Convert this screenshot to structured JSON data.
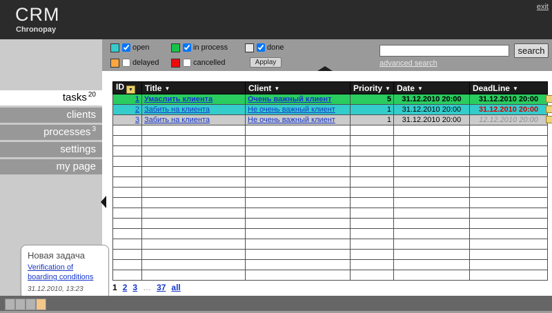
{
  "header": {
    "logo_title": "CRM",
    "logo_subtitle": "Chronopay",
    "exit_label": "exit"
  },
  "filters": {
    "items": [
      {
        "label": "open",
        "swatch_color": "#35cccc",
        "checked": true
      },
      {
        "label": "in process",
        "swatch_color": "#17c24a",
        "checked": true
      },
      {
        "label": "done",
        "swatch_color": "#e8e8e8",
        "checked": true
      },
      {
        "label": "delayed",
        "swatch_color": "#ffa640",
        "checked": false
      },
      {
        "label": "cancelled",
        "swatch_color": "#ea0c0c",
        "checked": false
      }
    ],
    "apply_label": "Applay"
  },
  "search": {
    "value": "",
    "button_label": "search",
    "advanced_label": "advanced search"
  },
  "sidebar": {
    "items": [
      {
        "label": "tasks",
        "badge": "20",
        "active": true
      },
      {
        "label": "clients",
        "badge": "",
        "active": false
      },
      {
        "label": "processes",
        "badge": "3",
        "active": false
      },
      {
        "label": "settings",
        "badge": "",
        "active": false
      },
      {
        "label": "my page",
        "badge": "",
        "active": false
      }
    ]
  },
  "notification": {
    "title": "Новая задача",
    "link": "Verification of boarding conditions",
    "timestamp": "31.12.2010, 13:23"
  },
  "table": {
    "sort_arrow": "▼",
    "columns": [
      {
        "label": "ID"
      },
      {
        "label": "Title"
      },
      {
        "label": "Client"
      },
      {
        "label": "Priority"
      },
      {
        "label": "Date"
      },
      {
        "label": "DeadLine"
      }
    ],
    "rows": [
      {
        "id": "1",
        "title": "Умаслить клиента",
        "client": "Очень важный клиент",
        "priority": "5",
        "date": "31.12.2010 20:00",
        "deadline": "31.12.2010 20:00",
        "row_color": "#2acc60",
        "bold": true,
        "deadline_style": "normal",
        "has_note": true
      },
      {
        "id": "2",
        "title": "Забить на клиента",
        "client": "Не очень важный клиент",
        "priority": "1",
        "date": "31.12.2010 20:00",
        "deadline": "31.12.2010 20:00",
        "row_color": "#35cccc",
        "bold": false,
        "deadline_style": "overdue-red",
        "has_note": true
      },
      {
        "id": "3",
        "title": "Забить на клиента",
        "client": "Не очень важный клиент",
        "priority": "1",
        "date": "31.12.2010 20:00",
        "deadline": "12.12.2010 20:00",
        "row_color": "#cbcbcb",
        "bold": false,
        "deadline_style": "past-gray",
        "has_note": true
      }
    ],
    "empty_row_count": 15
  },
  "pagination": {
    "items": [
      {
        "label": "1",
        "kind": "current"
      },
      {
        "label": "2",
        "kind": "link"
      },
      {
        "label": "3",
        "kind": "link"
      },
      {
        "label": "…",
        "kind": "ellipsis"
      },
      {
        "label": "37",
        "kind": "link"
      },
      {
        "label": "all",
        "kind": "link"
      }
    ]
  },
  "bottom_bar": {
    "squares": [
      {
        "color": "#b3b3b3"
      },
      {
        "color": "#b3b3b3"
      },
      {
        "color": "#b3b3b3"
      },
      {
        "color": "#f2c78a"
      }
    ]
  }
}
